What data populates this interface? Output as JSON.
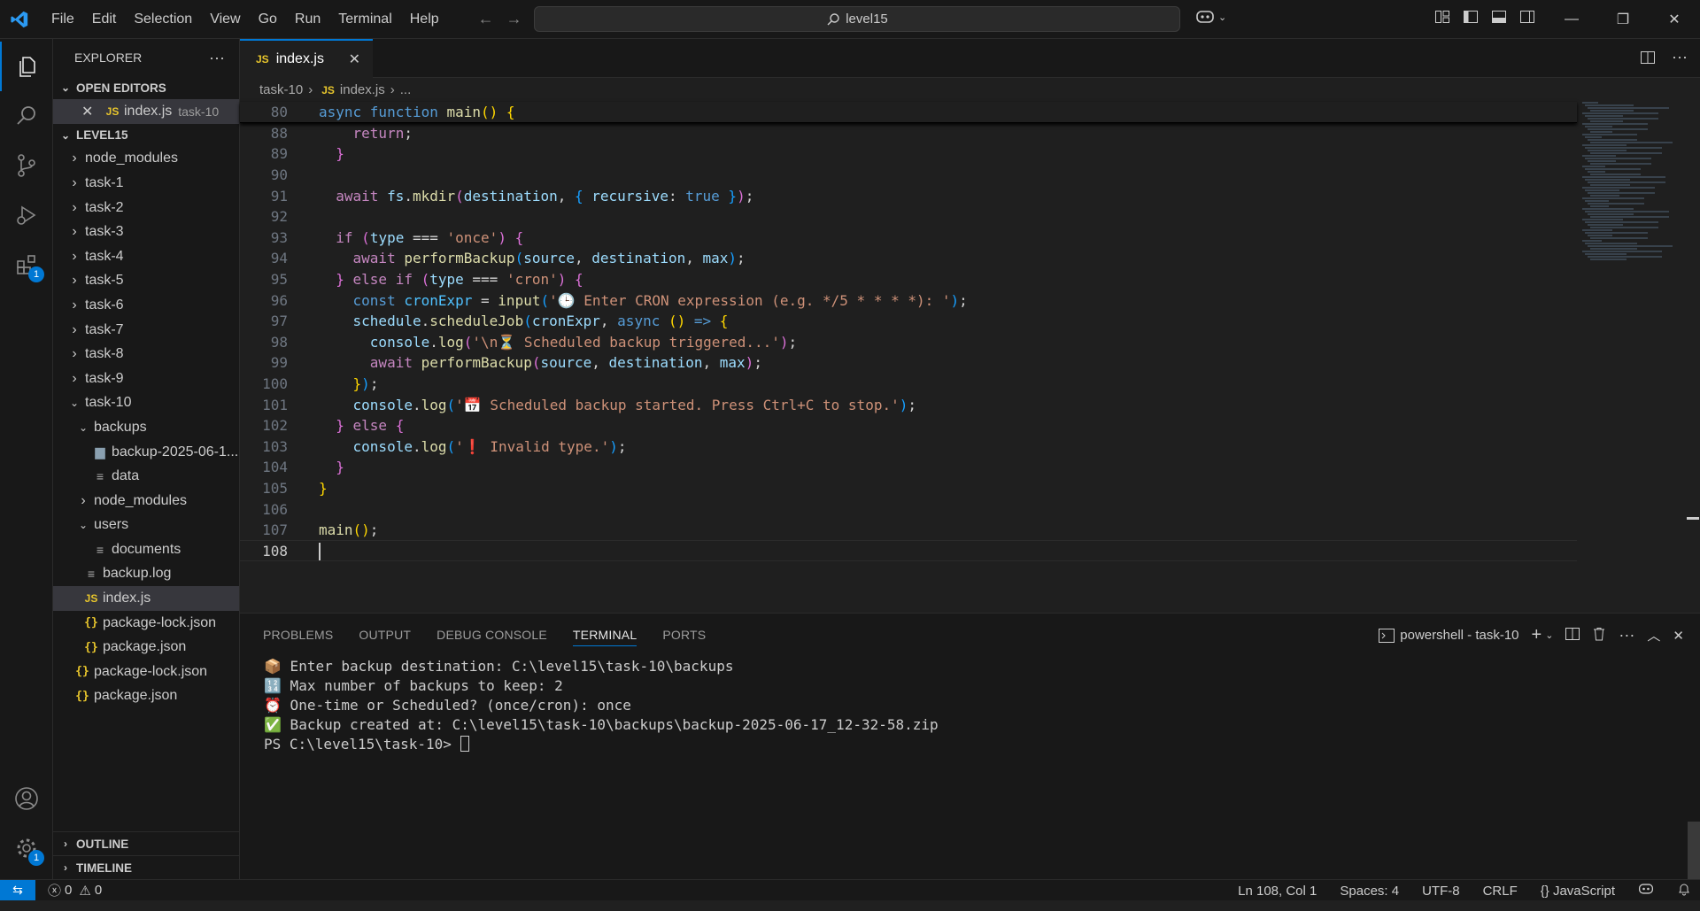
{
  "menu": [
    "File",
    "Edit",
    "Selection",
    "View",
    "Go",
    "Run",
    "Terminal",
    "Help"
  ],
  "search": {
    "label": "level15"
  },
  "explorer": {
    "title": "EXPLORER",
    "open_editors_label": "OPEN EDITORS",
    "open_editor": {
      "name": "index.js",
      "folder": "task-10"
    },
    "root_label": "LEVEL15",
    "items": [
      {
        "label": "node_modules",
        "kind": "folder",
        "depth": 1,
        "expanded": false
      },
      {
        "label": "task-1",
        "kind": "folder",
        "depth": 1,
        "expanded": false
      },
      {
        "label": "task-2",
        "kind": "folder",
        "depth": 1,
        "expanded": false
      },
      {
        "label": "task-3",
        "kind": "folder",
        "depth": 1,
        "expanded": false
      },
      {
        "label": "task-4",
        "kind": "folder",
        "depth": 1,
        "expanded": false
      },
      {
        "label": "task-5",
        "kind": "folder",
        "depth": 1,
        "expanded": false
      },
      {
        "label": "task-6",
        "kind": "folder",
        "depth": 1,
        "expanded": false
      },
      {
        "label": "task-7",
        "kind": "folder",
        "depth": 1,
        "expanded": false
      },
      {
        "label": "task-8",
        "kind": "folder",
        "depth": 1,
        "expanded": false
      },
      {
        "label": "task-9",
        "kind": "folder",
        "depth": 1,
        "expanded": false
      },
      {
        "label": "task-10",
        "kind": "folder",
        "depth": 1,
        "expanded": true
      },
      {
        "label": "backups",
        "kind": "folder",
        "depth": 2,
        "expanded": true
      },
      {
        "label": "backup-2025-06-1...",
        "kind": "zip",
        "depth": 3
      },
      {
        "label": "data",
        "kind": "txt",
        "depth": 3
      },
      {
        "label": "node_modules",
        "kind": "folder",
        "depth": 2,
        "expanded": false
      },
      {
        "label": "users",
        "kind": "folder",
        "depth": 2,
        "expanded": true
      },
      {
        "label": "documents",
        "kind": "txt",
        "depth": 3
      },
      {
        "label": "backup.log",
        "kind": "txt",
        "depth": 2
      },
      {
        "label": "index.js",
        "kind": "js",
        "depth": 2,
        "selected": true
      },
      {
        "label": "package-lock.json",
        "kind": "json",
        "depth": 2
      },
      {
        "label": "package.json",
        "kind": "json",
        "depth": 2
      },
      {
        "label": "package-lock.json",
        "kind": "json",
        "depth": 1
      },
      {
        "label": "package.json",
        "kind": "json",
        "depth": 1
      }
    ],
    "outline_label": "OUTLINE",
    "timeline_label": "TIMELINE"
  },
  "activity": {
    "extensions_badge": "1",
    "settings_badge": "1"
  },
  "editor": {
    "tab": {
      "icon": "JS",
      "label": "index.js"
    },
    "breadcrumb": {
      "folder": "task-10",
      "file": "index.js",
      "more": "..."
    },
    "lines": [
      {
        "n": "80",
        "tokens": [
          [
            "kw",
            "async "
          ],
          [
            "kw",
            "function "
          ],
          [
            "fn",
            "main"
          ],
          [
            "b1",
            "() {"
          ]
        ]
      },
      {
        "n": "88",
        "tokens": [
          [
            "ctl",
            "    return"
          ],
          [
            "op",
            ";"
          ]
        ]
      },
      {
        "n": "89",
        "tokens": [
          [
            "b2",
            "  }"
          ]
        ]
      },
      {
        "n": "90",
        "tokens": []
      },
      {
        "n": "91",
        "tokens": [
          [
            "ctl",
            "  await "
          ],
          [
            "vr",
            "fs"
          ],
          [
            "op",
            "."
          ],
          [
            "fn",
            "mkdir"
          ],
          [
            "b2",
            "("
          ],
          [
            "vr",
            "destination"
          ],
          [
            "op",
            ", "
          ],
          [
            "b3",
            "{ "
          ],
          [
            "vr",
            "recursive"
          ],
          [
            "op",
            ": "
          ],
          [
            "kw",
            "true "
          ],
          [
            "b3",
            "}"
          ],
          [
            "b2",
            ")"
          ],
          [
            "op",
            ";"
          ]
        ]
      },
      {
        "n": "92",
        "tokens": []
      },
      {
        "n": "93",
        "tokens": [
          [
            "ctl",
            "  if "
          ],
          [
            "b2",
            "("
          ],
          [
            "vr",
            "type "
          ],
          [
            "op",
            "=== "
          ],
          [
            "st",
            "'once'"
          ],
          [
            "b2",
            ") {"
          ]
        ]
      },
      {
        "n": "94",
        "tokens": [
          [
            "ctl",
            "    await "
          ],
          [
            "fn",
            "performBackup"
          ],
          [
            "b3",
            "("
          ],
          [
            "vr",
            "source"
          ],
          [
            "op",
            ", "
          ],
          [
            "vr",
            "destination"
          ],
          [
            "op",
            ", "
          ],
          [
            "vr",
            "max"
          ],
          [
            "b3",
            ")"
          ],
          [
            "op",
            ";"
          ]
        ]
      },
      {
        "n": "95",
        "tokens": [
          [
            "b2",
            "  } "
          ],
          [
            "ctl",
            "else if "
          ],
          [
            "b2",
            "("
          ],
          [
            "vr",
            "type "
          ],
          [
            "op",
            "=== "
          ],
          [
            "st",
            "'cron'"
          ],
          [
            "b2",
            ") {"
          ]
        ]
      },
      {
        "n": "96",
        "tokens": [
          [
            "kw",
            "    const "
          ],
          [
            "cn",
            "cronExpr "
          ],
          [
            "op",
            "= "
          ],
          [
            "fn",
            "input"
          ],
          [
            "b3",
            "("
          ],
          [
            "st",
            "'🕒 Enter CRON expression (e.g. */5 * * * *): '"
          ],
          [
            "b3",
            ")"
          ],
          [
            "op",
            ";"
          ]
        ]
      },
      {
        "n": "97",
        "tokens": [
          [
            "vr",
            "    schedule"
          ],
          [
            "op",
            "."
          ],
          [
            "fn",
            "scheduleJob"
          ],
          [
            "b3",
            "("
          ],
          [
            "vr",
            "cronExpr"
          ],
          [
            "op",
            ", "
          ],
          [
            "kw",
            "async "
          ],
          [
            "b1",
            "() "
          ],
          [
            "kw",
            "=> "
          ],
          [
            "b1",
            "{"
          ]
        ]
      },
      {
        "n": "98",
        "tokens": [
          [
            "vr",
            "      console"
          ],
          [
            "op",
            "."
          ],
          [
            "fn",
            "log"
          ],
          [
            "b2",
            "("
          ],
          [
            "st",
            "'\\n⏳ Scheduled backup triggered...'"
          ],
          [
            "b2",
            ")"
          ],
          [
            "op",
            ";"
          ]
        ]
      },
      {
        "n": "99",
        "tokens": [
          [
            "ctl",
            "      await "
          ],
          [
            "fn",
            "performBackup"
          ],
          [
            "b2",
            "("
          ],
          [
            "vr",
            "source"
          ],
          [
            "op",
            ", "
          ],
          [
            "vr",
            "destination"
          ],
          [
            "op",
            ", "
          ],
          [
            "vr",
            "max"
          ],
          [
            "b2",
            ")"
          ],
          [
            "op",
            ";"
          ]
        ]
      },
      {
        "n": "100",
        "tokens": [
          [
            "b1",
            "    }"
          ],
          [
            "b3",
            ")"
          ],
          [
            "op",
            ";"
          ]
        ]
      },
      {
        "n": "101",
        "tokens": [
          [
            "vr",
            "    console"
          ],
          [
            "op",
            "."
          ],
          [
            "fn",
            "log"
          ],
          [
            "b3",
            "("
          ],
          [
            "st",
            "'📅 Scheduled backup started. Press Ctrl+C to stop.'"
          ],
          [
            "b3",
            ")"
          ],
          [
            "op",
            ";"
          ]
        ]
      },
      {
        "n": "102",
        "tokens": [
          [
            "b2",
            "  } "
          ],
          [
            "ctl",
            "else "
          ],
          [
            "b2",
            "{"
          ]
        ]
      },
      {
        "n": "103",
        "tokens": [
          [
            "vr",
            "    console"
          ],
          [
            "op",
            "."
          ],
          [
            "fn",
            "log"
          ],
          [
            "b3",
            "("
          ],
          [
            "st",
            "'❗ Invalid type.'"
          ],
          [
            "b3",
            ")"
          ],
          [
            "op",
            ";"
          ]
        ]
      },
      {
        "n": "104",
        "tokens": [
          [
            "b2",
            "  }"
          ]
        ]
      },
      {
        "n": "105",
        "tokens": [
          [
            "b1",
            "}"
          ]
        ]
      },
      {
        "n": "106",
        "tokens": []
      },
      {
        "n": "107",
        "tokens": [
          [
            "fn",
            "main"
          ],
          [
            "b1",
            "()"
          ],
          [
            "op",
            ";"
          ]
        ]
      },
      {
        "n": "108",
        "tokens": [],
        "current": true
      }
    ]
  },
  "panel": {
    "tabs": [
      "PROBLEMS",
      "OUTPUT",
      "DEBUG CONSOLE",
      "TERMINAL",
      "PORTS"
    ],
    "active_tab": "TERMINAL",
    "terminal_name": "powershell - task-10",
    "lines": [
      "📦 Enter backup destination: C:\\level15\\task-10\\backups",
      "🔢 Max number of backups to keep: 2",
      "⏰ One-time or Scheduled? (once/cron): once",
      "✅ Backup created at: C:\\level15\\task-10\\backups\\backup-2025-06-17_12-32-58.zip"
    ],
    "prompt": "PS C:\\level15\\task-10> "
  },
  "status": {
    "errors": "0",
    "warnings": "0",
    "position": "Ln 108, Col 1",
    "spaces": "Spaces: 4",
    "encoding": "UTF-8",
    "eol": "CRLF",
    "language": "JavaScript"
  },
  "colors": {
    "accent": "#0078d4",
    "background": "#1f1f1f",
    "sidebar": "#181818"
  }
}
